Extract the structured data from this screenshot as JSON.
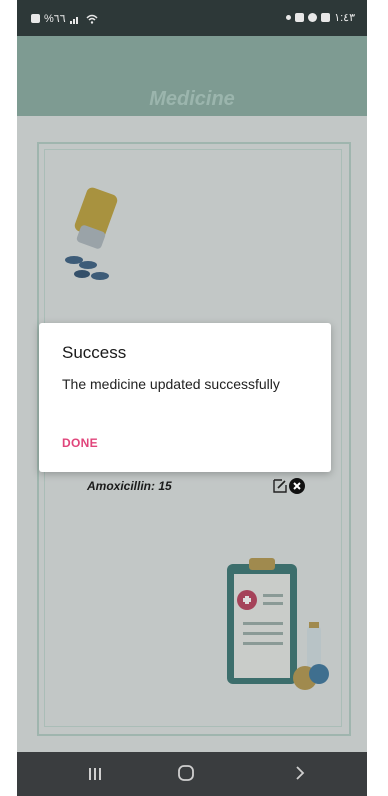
{
  "status_bar": {
    "left_text": "%٦٦",
    "time": "١:٤٣"
  },
  "app": {
    "title": "Medicine"
  },
  "medicine_item": {
    "text": "Amoxicillin: 15"
  },
  "dialog": {
    "title": "Success",
    "message": "The medicine updated successfully",
    "button_label": "DONE"
  },
  "colors": {
    "accent": "#e0457b",
    "appbar": "#7e9b92"
  }
}
